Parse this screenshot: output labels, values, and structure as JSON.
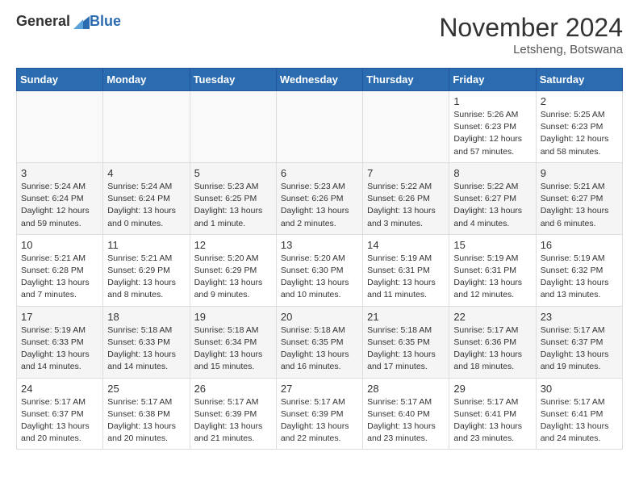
{
  "header": {
    "logo_general": "General",
    "logo_blue": "Blue",
    "month_title": "November 2024",
    "location": "Letsheng, Botswana"
  },
  "weekdays": [
    "Sunday",
    "Monday",
    "Tuesday",
    "Wednesday",
    "Thursday",
    "Friday",
    "Saturday"
  ],
  "weeks": [
    [
      {
        "day": "",
        "info": ""
      },
      {
        "day": "",
        "info": ""
      },
      {
        "day": "",
        "info": ""
      },
      {
        "day": "",
        "info": ""
      },
      {
        "day": "",
        "info": ""
      },
      {
        "day": "1",
        "info": "Sunrise: 5:26 AM\nSunset: 6:23 PM\nDaylight: 12 hours\nand 57 minutes."
      },
      {
        "day": "2",
        "info": "Sunrise: 5:25 AM\nSunset: 6:23 PM\nDaylight: 12 hours\nand 58 minutes."
      }
    ],
    [
      {
        "day": "3",
        "info": "Sunrise: 5:24 AM\nSunset: 6:24 PM\nDaylight: 12 hours\nand 59 minutes."
      },
      {
        "day": "4",
        "info": "Sunrise: 5:24 AM\nSunset: 6:24 PM\nDaylight: 13 hours\nand 0 minutes."
      },
      {
        "day": "5",
        "info": "Sunrise: 5:23 AM\nSunset: 6:25 PM\nDaylight: 13 hours\nand 1 minute."
      },
      {
        "day": "6",
        "info": "Sunrise: 5:23 AM\nSunset: 6:26 PM\nDaylight: 13 hours\nand 2 minutes."
      },
      {
        "day": "7",
        "info": "Sunrise: 5:22 AM\nSunset: 6:26 PM\nDaylight: 13 hours\nand 3 minutes."
      },
      {
        "day": "8",
        "info": "Sunrise: 5:22 AM\nSunset: 6:27 PM\nDaylight: 13 hours\nand 4 minutes."
      },
      {
        "day": "9",
        "info": "Sunrise: 5:21 AM\nSunset: 6:27 PM\nDaylight: 13 hours\nand 6 minutes."
      }
    ],
    [
      {
        "day": "10",
        "info": "Sunrise: 5:21 AM\nSunset: 6:28 PM\nDaylight: 13 hours\nand 7 minutes."
      },
      {
        "day": "11",
        "info": "Sunrise: 5:21 AM\nSunset: 6:29 PM\nDaylight: 13 hours\nand 8 minutes."
      },
      {
        "day": "12",
        "info": "Sunrise: 5:20 AM\nSunset: 6:29 PM\nDaylight: 13 hours\nand 9 minutes."
      },
      {
        "day": "13",
        "info": "Sunrise: 5:20 AM\nSunset: 6:30 PM\nDaylight: 13 hours\nand 10 minutes."
      },
      {
        "day": "14",
        "info": "Sunrise: 5:19 AM\nSunset: 6:31 PM\nDaylight: 13 hours\nand 11 minutes."
      },
      {
        "day": "15",
        "info": "Sunrise: 5:19 AM\nSunset: 6:31 PM\nDaylight: 13 hours\nand 12 minutes."
      },
      {
        "day": "16",
        "info": "Sunrise: 5:19 AM\nSunset: 6:32 PM\nDaylight: 13 hours\nand 13 minutes."
      }
    ],
    [
      {
        "day": "17",
        "info": "Sunrise: 5:19 AM\nSunset: 6:33 PM\nDaylight: 13 hours\nand 14 minutes."
      },
      {
        "day": "18",
        "info": "Sunrise: 5:18 AM\nSunset: 6:33 PM\nDaylight: 13 hours\nand 14 minutes."
      },
      {
        "day": "19",
        "info": "Sunrise: 5:18 AM\nSunset: 6:34 PM\nDaylight: 13 hours\nand 15 minutes."
      },
      {
        "day": "20",
        "info": "Sunrise: 5:18 AM\nSunset: 6:35 PM\nDaylight: 13 hours\nand 16 minutes."
      },
      {
        "day": "21",
        "info": "Sunrise: 5:18 AM\nSunset: 6:35 PM\nDaylight: 13 hours\nand 17 minutes."
      },
      {
        "day": "22",
        "info": "Sunrise: 5:17 AM\nSunset: 6:36 PM\nDaylight: 13 hours\nand 18 minutes."
      },
      {
        "day": "23",
        "info": "Sunrise: 5:17 AM\nSunset: 6:37 PM\nDaylight: 13 hours\nand 19 minutes."
      }
    ],
    [
      {
        "day": "24",
        "info": "Sunrise: 5:17 AM\nSunset: 6:37 PM\nDaylight: 13 hours\nand 20 minutes."
      },
      {
        "day": "25",
        "info": "Sunrise: 5:17 AM\nSunset: 6:38 PM\nDaylight: 13 hours\nand 20 minutes."
      },
      {
        "day": "26",
        "info": "Sunrise: 5:17 AM\nSunset: 6:39 PM\nDaylight: 13 hours\nand 21 minutes."
      },
      {
        "day": "27",
        "info": "Sunrise: 5:17 AM\nSunset: 6:39 PM\nDaylight: 13 hours\nand 22 minutes."
      },
      {
        "day": "28",
        "info": "Sunrise: 5:17 AM\nSunset: 6:40 PM\nDaylight: 13 hours\nand 23 minutes."
      },
      {
        "day": "29",
        "info": "Sunrise: 5:17 AM\nSunset: 6:41 PM\nDaylight: 13 hours\nand 23 minutes."
      },
      {
        "day": "30",
        "info": "Sunrise: 5:17 AM\nSunset: 6:41 PM\nDaylight: 13 hours\nand 24 minutes."
      }
    ]
  ]
}
